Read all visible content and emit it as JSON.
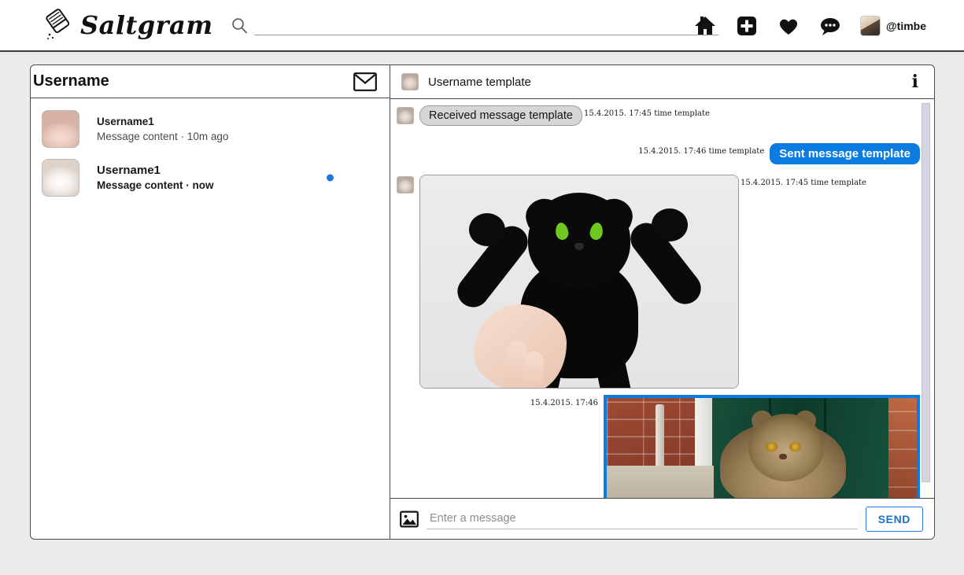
{
  "app": {
    "brand_name": "Saltgram",
    "logo_icon": "salt-shaker-icon"
  },
  "search": {
    "icon": "search-icon",
    "placeholder": "",
    "value": ""
  },
  "nav": {
    "items": [
      {
        "icon": "home-icon",
        "label": "Home"
      },
      {
        "icon": "add-post-icon",
        "label": "Add"
      },
      {
        "icon": "heart-icon",
        "label": "Likes"
      },
      {
        "icon": "chat-bubble-icon",
        "label": "Messages"
      }
    ],
    "account": {
      "handle": "@timbe",
      "avatar_icon": "user-avatar"
    }
  },
  "conversations_panel": {
    "title": "Username",
    "compose_icon": "envelope-icon",
    "items": [
      {
        "name": "Username1",
        "preview": "Message content · 10m ago",
        "unread": false,
        "avatar_icon": "cat-avatar-1"
      },
      {
        "name": "Username1",
        "preview": "Message content · now",
        "unread": true,
        "avatar_icon": "cat-avatar-2"
      }
    ]
  },
  "chat": {
    "header": {
      "avatar_icon": "cat-avatar-3",
      "title": "Username template",
      "info_icon": "info-icon"
    },
    "messages": [
      {
        "direction": "received",
        "type": "text",
        "text": "Received message template",
        "timestamp": "15.4.2015. 17:45 time template",
        "avatar_icon": "cat-avatar-3"
      },
      {
        "direction": "sent",
        "type": "text",
        "text": "Sent message template",
        "timestamp": "15.4.2015. 17:46 time template"
      },
      {
        "direction": "received",
        "type": "image",
        "alt": "black-plush-cat-photo",
        "timestamp": "15.4.2015. 17:45 time template",
        "avatar_icon": "cat-avatar-3"
      },
      {
        "direction": "sent",
        "type": "image",
        "alt": "persian-cat-by-green-door-photo",
        "timestamp": "15.4.2015. 17:46"
      }
    ],
    "composer": {
      "attach_icon": "image-icon",
      "placeholder": "Enter a message",
      "value": "",
      "send_label": "SEND"
    }
  },
  "colors": {
    "accent_blue": "#0d7ce0",
    "unread_dot": "#1877e0",
    "received_bubble": "#d6d6d6",
    "page_background": "#ebebeb",
    "send_button_text": "#1a72c8"
  }
}
